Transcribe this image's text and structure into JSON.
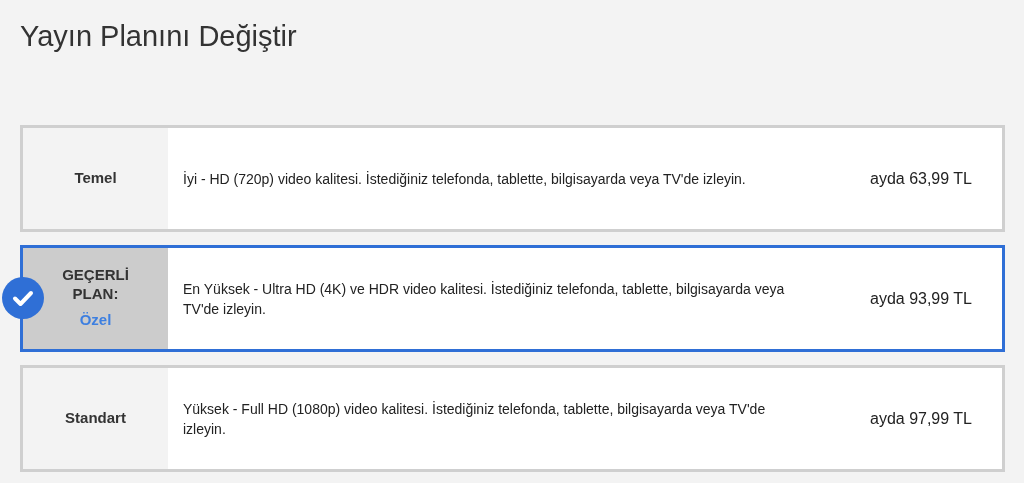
{
  "title": "Yayın Planını Değiştir",
  "plans": [
    {
      "name": "Temel",
      "description": "İyi - HD (720p) video kalitesi. İstediğiniz telefonda, tablette, bilgisayarda veya TV'de izleyin.",
      "price": "ayda 63,99 TL",
      "selected": false
    },
    {
      "name": "Özel",
      "current_label": "GEÇERLİ PLAN:",
      "description": "En Yüksek - Ultra HD (4K) ve HDR video kalitesi. İstediğiniz telefonda, tablette, bilgisayarda veya TV'de izleyin.",
      "price": "ayda 93,99 TL",
      "selected": true
    },
    {
      "name": "Standart",
      "description": "Yüksek - Full HD (1080p) video kalitesi. İstediğiniz telefonda, tablette, bilgisayarda veya TV'de izleyin.",
      "price": "ayda 97,99 TL",
      "selected": false
    }
  ]
}
